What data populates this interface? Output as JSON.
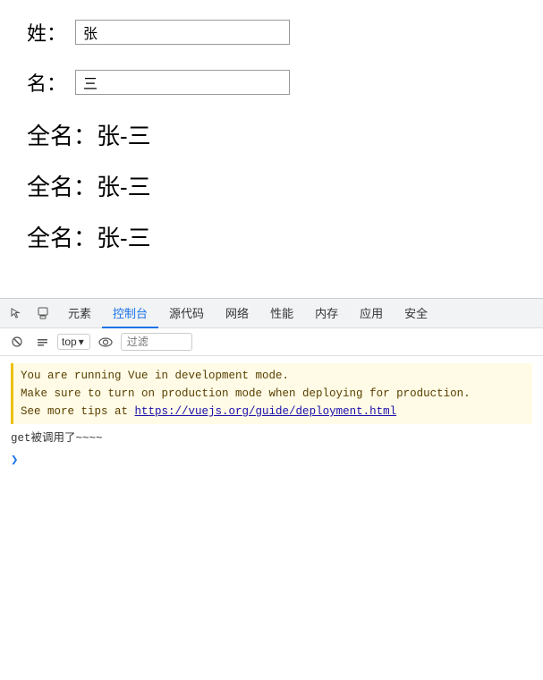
{
  "form": {
    "last_name_label": "姓：",
    "last_name_value": "张",
    "first_name_label": "名：",
    "first_name_value": "三"
  },
  "fullnames": [
    {
      "label": "全名：张-三"
    },
    {
      "label": "全名：张-三"
    },
    {
      "label": "全名：张-三"
    }
  ],
  "devtools": {
    "tabs": [
      {
        "label": "元素",
        "active": false
      },
      {
        "label": "控制台",
        "active": true
      },
      {
        "label": "源代码",
        "active": false
      },
      {
        "label": "网络",
        "active": false
      },
      {
        "label": "性能",
        "active": false
      },
      {
        "label": "内存",
        "active": false
      },
      {
        "label": "应用",
        "active": false
      },
      {
        "label": "安全",
        "active": false
      }
    ],
    "toolbar": {
      "top_label": "top",
      "filter_placeholder": "过滤"
    },
    "console_lines": [
      "You are running Vue in development mode.",
      "Make sure to turn on production mode when deploying for production.",
      "See more tips at ",
      "https://vuejs.org/guide/deployment.html",
      "get被调用了~~~~"
    ]
  }
}
